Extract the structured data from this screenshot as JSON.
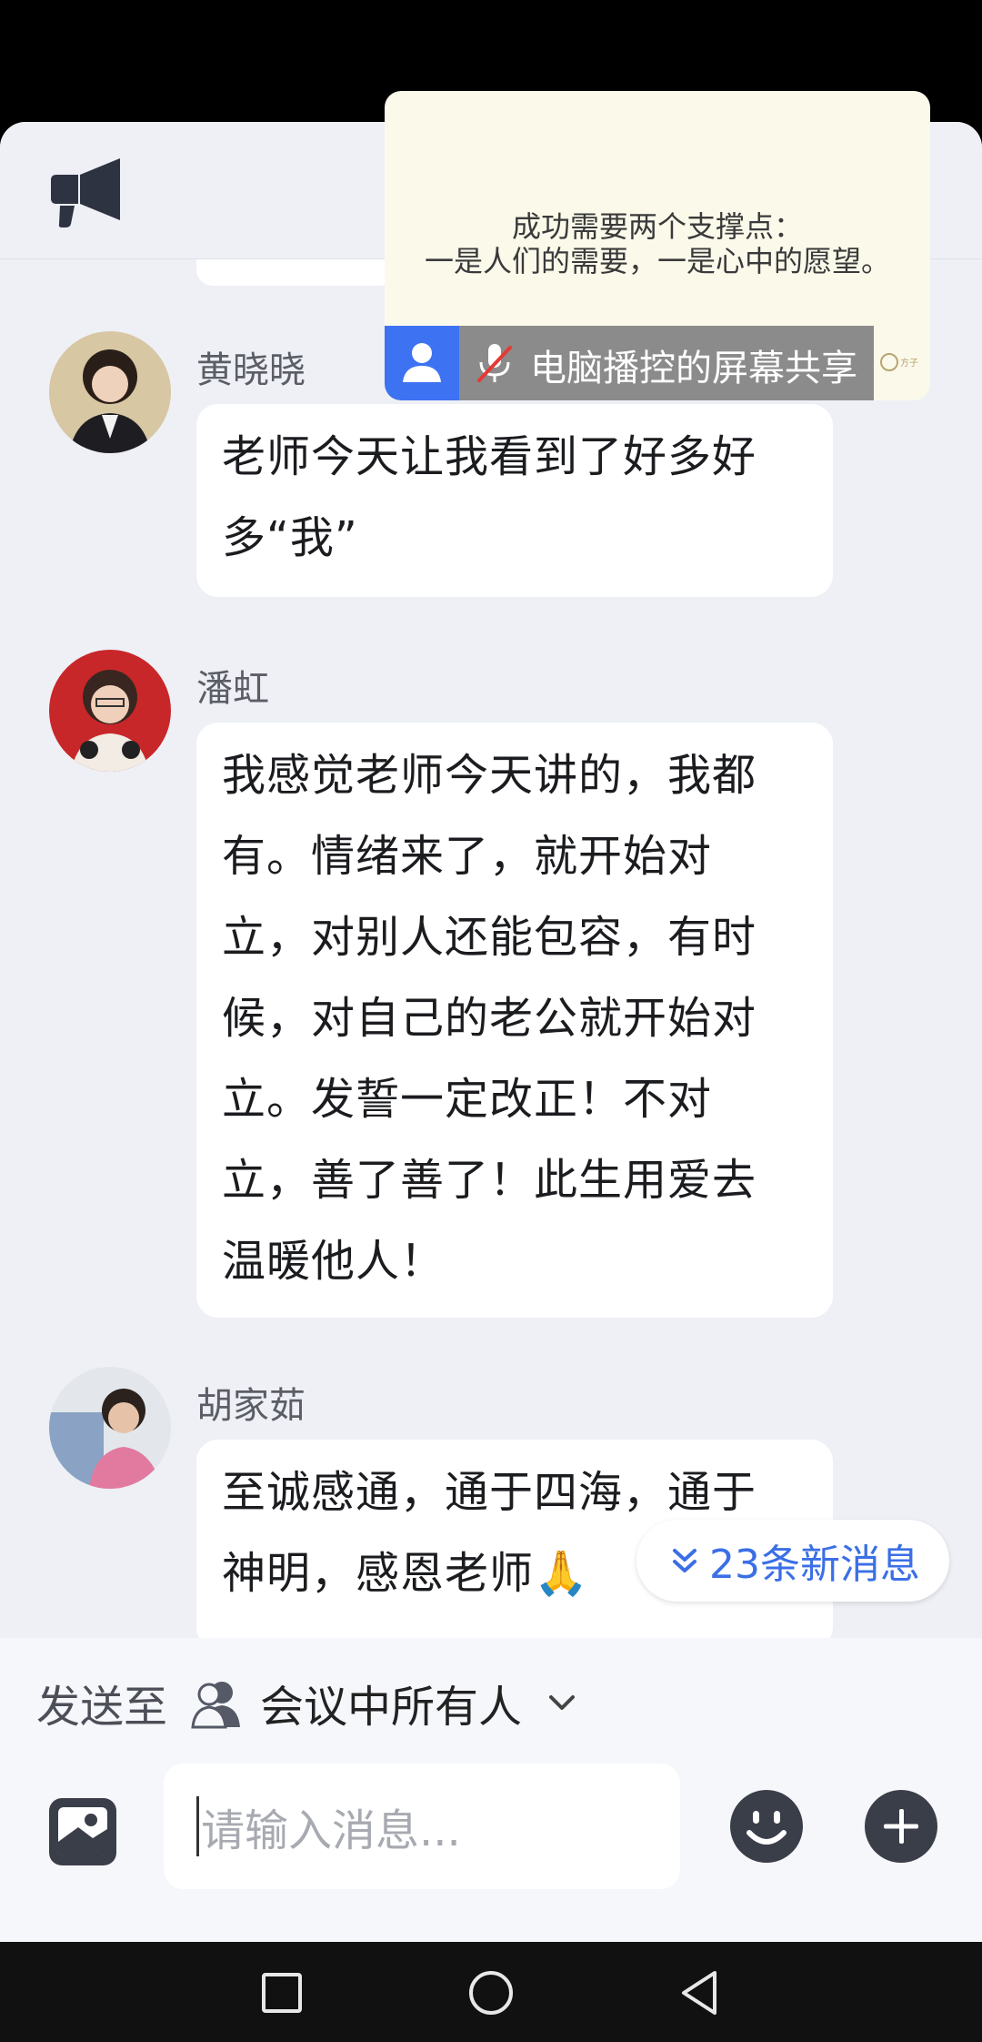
{
  "screen_share": {
    "quote_line1": "成功需要两个支撑点：",
    "quote_line2": "一是人们的需要，一是心中的愿望。",
    "status_label": "电脑播控的屏幕共享",
    "logo_text": "方子"
  },
  "messages": [
    {
      "sender": "黄晓晓",
      "lines": [
        "老师今天让我看到了好多好",
        "多“我”"
      ]
    },
    {
      "sender": "潘虹",
      "lines": [
        "我感觉老师今天讲的，我都",
        "有。情绪来了，就开始对",
        "立，对别人还能包容，有时",
        "候，对自己的老公就开始对",
        "立。发誓一定改正！不对",
        "立，善了善了！此生用爱去",
        "温暖他人！"
      ]
    },
    {
      "sender": "胡家茹",
      "lines": [
        "至诚感通，通于四海，通于",
        "神明，感恩老师🙏"
      ]
    }
  ],
  "new_messages_label": "23条新消息",
  "composer": {
    "send_to_label": "发送至",
    "send_to_target": "会议中所有人",
    "input_placeholder": "请输入消息..."
  },
  "colors": {
    "accent": "#3b6fe6",
    "app_bg": "#eef0f6",
    "bubble": "#ffffff"
  }
}
